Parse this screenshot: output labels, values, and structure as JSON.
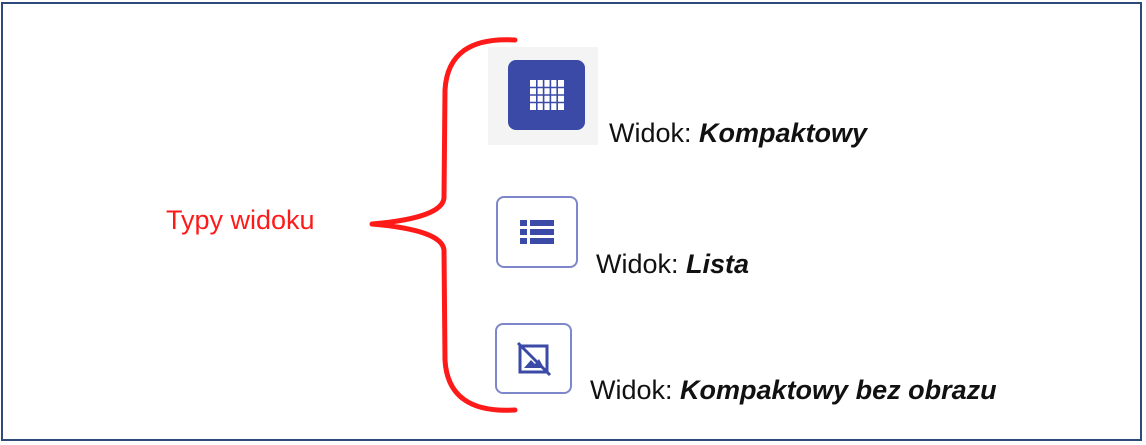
{
  "group_label": "Typy widoku",
  "views": [
    {
      "prefix": "Widok:",
      "name": "Kompaktowy",
      "icon": "grid-icon"
    },
    {
      "prefix": "Widok:",
      "name": "Lista",
      "icon": "list-icon"
    },
    {
      "prefix": "Widok:",
      "name": "Kompaktowy bez obrazu",
      "icon": "no-image-icon"
    }
  ],
  "colors": {
    "brace": "#ff1a1a",
    "label_red": "#ff1a1a",
    "icon_fill": "#3b4aa6",
    "icon_outline": "#7d87c9",
    "frame_border": "#2e4a7a"
  }
}
